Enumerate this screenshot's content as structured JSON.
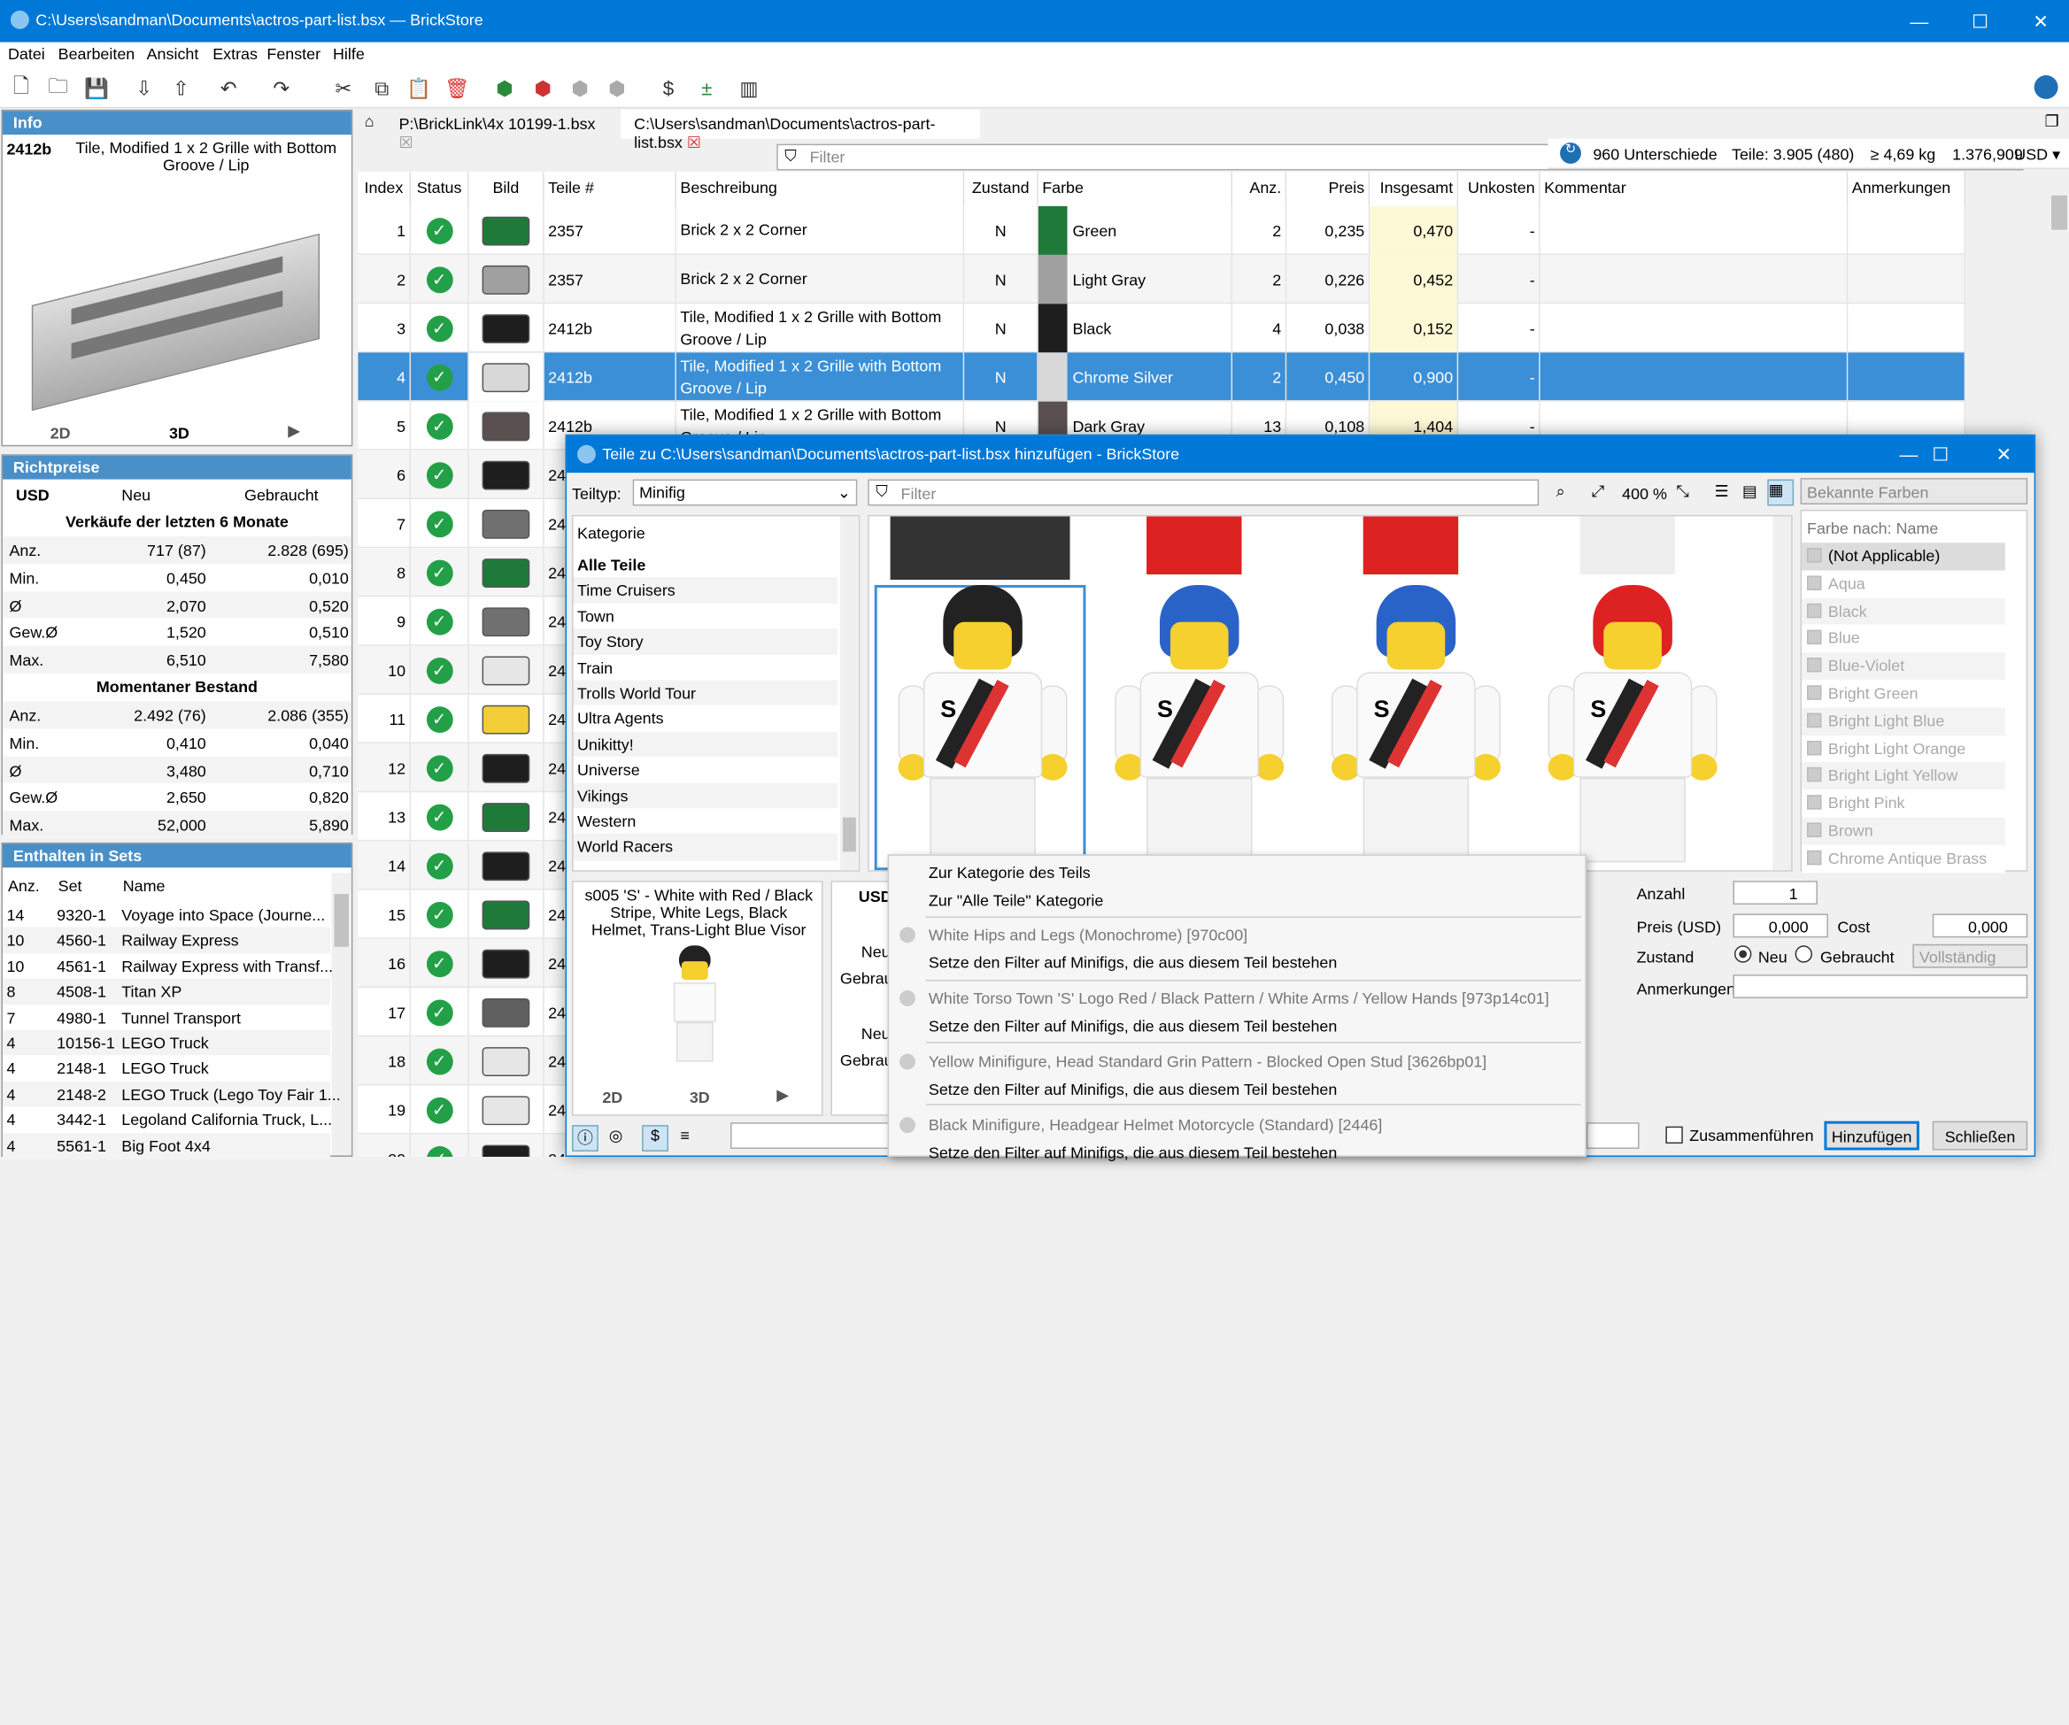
{
  "window": {
    "title": "C:\\Users\\sandman\\Documents\\actros-part-list.bsx — BrickStore"
  },
  "menu": [
    "Datei",
    "Bearbeiten",
    "Ansicht",
    "Extras",
    "Fenster",
    "Hilfe"
  ],
  "toolbar": {
    "filter_placeholder": "Filter"
  },
  "info": {
    "header": "Info",
    "part_id": "2412b",
    "part_name": "Tile, Modified 1 x 2 Grille with Bottom Groove / Lip",
    "tab_2d": "2D",
    "tab_3d": "3D"
  },
  "prices": {
    "header": "Richtpreise",
    "currency": "USD",
    "col_new": "Neu",
    "col_used": "Gebraucht",
    "sales_title": "Verkäufe der letzten 6 Monate",
    "stock_title": "Momentaner Bestand",
    "sales": [
      {
        "label": "Anz.",
        "new": "717 (87)",
        "used": "2.828 (695)"
      },
      {
        "label": "Min.",
        "new": "0,450",
        "used": "0,010"
      },
      {
        "label": "Ø",
        "new": "2,070",
        "used": "0,520"
      },
      {
        "label": "Gew.Ø",
        "new": "1,520",
        "used": "0,510"
      },
      {
        "label": "Max.",
        "new": "6,510",
        "used": "7,580"
      }
    ],
    "stock": [
      {
        "label": "Anz.",
        "new": "2.492 (76)",
        "used": "2.086 (355)"
      },
      {
        "label": "Min.",
        "new": "0,410",
        "used": "0,040"
      },
      {
        "label": "Ø",
        "new": "3,480",
        "used": "0,710"
      },
      {
        "label": "Gew.Ø",
        "new": "2,650",
        "used": "0,820"
      },
      {
        "label": "Max.",
        "new": "52,000",
        "used": "5,890"
      }
    ]
  },
  "sets": {
    "header": "Enthalten in Sets",
    "cols": [
      "Anz.",
      "Set",
      "Name"
    ],
    "rows": [
      [
        "14",
        "9320-1",
        "Voyage into Space (Journe..."
      ],
      [
        "10",
        "4560-1",
        "Railway Express"
      ],
      [
        "10",
        "4561-1",
        "Railway Express with Transf..."
      ],
      [
        "8",
        "4508-1",
        "Titan XP"
      ],
      [
        "7",
        "4980-1",
        "Tunnel Transport"
      ],
      [
        "4",
        "10156-1",
        "LEGO Truck"
      ],
      [
        "4",
        "2148-1",
        "LEGO Truck"
      ],
      [
        "4",
        "2148-2",
        "LEGO Truck (Lego Toy Fair 1..."
      ],
      [
        "4",
        "3442-1",
        "Legoland California Truck, L..."
      ],
      [
        "4",
        "5561-1",
        "Big Foot 4x4"
      ]
    ]
  },
  "tabs": [
    "P:\\BrickLink\\4x 10199-1.bsx",
    "C:\\Users\\sandman\\Documents\\actros-part-list.bsx"
  ],
  "status": {
    "diffs": "960 Unterschiede",
    "parts": "Teile: 3.905 (480)",
    "weight": "≥ 4,69 kg",
    "total": "1.376,909",
    "currency": "USD"
  },
  "grid": {
    "cols": [
      "Index",
      "Status",
      "Bild",
      "Teile #",
      "Beschreibung",
      "Zustand",
      "Farbe",
      "Anz.",
      "Preis",
      "Insgesamt",
      "Unkosten",
      "Kommentar",
      "Anmerkungen"
    ],
    "rows": [
      {
        "i": "1",
        "part": "2357",
        "desc": "Brick 2 x 2 Corner",
        "cond": "N",
        "color": "Green",
        "hex": "#1f7a3a",
        "qty": "2",
        "price": "0,235",
        "total": "0,470",
        "cost": "-"
      },
      {
        "i": "2",
        "part": "2357",
        "desc": "Brick 2 x 2 Corner",
        "cond": "N",
        "color": "Light Gray",
        "hex": "#a0a0a0",
        "qty": "2",
        "price": "0,226",
        "total": "0,452",
        "cost": "-"
      },
      {
        "i": "3",
        "part": "2412b",
        "desc": "Tile, Modified 1 x 2 Grille with Bottom Groove / Lip",
        "cond": "N",
        "color": "Black",
        "hex": "#1e1e1e",
        "qty": "4",
        "price": "0,038",
        "total": "0,152",
        "cost": "-"
      },
      {
        "i": "4",
        "part": "2412b",
        "desc": "Tile, Modified 1 x 2 Grille with Bottom Groove / Lip",
        "cond": "N",
        "color": "Chrome Silver",
        "hex": "#d8d8d8",
        "qty": "2",
        "price": "0,450",
        "total": "0,900",
        "cost": "-"
      },
      {
        "i": "5",
        "part": "2412b",
        "desc": "Tile, Modified 1 x 2 Grille with Bottom Groove / Lip",
        "cond": "N",
        "color": "Dark Gray",
        "hex": "#5a5050",
        "qty": "13",
        "price": "0,108",
        "total": "1,404",
        "cost": "-"
      }
    ],
    "more_indices": [
      "6",
      "7",
      "8",
      "9",
      "10",
      "11",
      "12",
      "13",
      "14",
      "15",
      "16",
      "17",
      "18",
      "19",
      "20"
    ],
    "more_part": "24"
  },
  "dialog": {
    "title": "Teile zu C:\\Users\\sandman\\Documents\\actros-part-list.bsx hinzufügen - BrickStore",
    "type_label": "Teiltyp:",
    "type_value": "Minifig",
    "filter_placeholder": "Filter",
    "zoom": "400 %",
    "known_colors": "Bekannte Farben",
    "color_sort": "Farbe nach: Name",
    "category_header": "Kategorie",
    "categories": [
      "Alle Teile",
      "Time Cruisers",
      "Town",
      "Toy Story",
      "Train",
      "Trolls World Tour",
      "Ultra Agents",
      "Unikitty!",
      "Universe",
      "Vikings",
      "Western",
      "World Racers"
    ],
    "colors": [
      "(Not Applicable)",
      "Aqua",
      "Black",
      "Blue",
      "Blue-Violet",
      "Bright Green",
      "Bright Light Blue",
      "Bright Light Orange",
      "Bright Light Yellow",
      "Bright Pink",
      "Brown",
      "Chrome Antique Brass"
    ],
    "selected_part": "s005 'S' - White with Red / Black Stripe, White Legs, Black Helmet, Trans-Light Blue Visor",
    "selected_id": "s005",
    "sel_2d": "2D",
    "sel_3d": "3D",
    "price_cur": "USD",
    "price_new": "Neu",
    "price_used": "Gebrau",
    "qty_label": "Anzahl",
    "qty_value": "1",
    "price_label": "Preis (USD)",
    "price_value": "0,000",
    "cost_label": "Cost",
    "cost_value": "0,000",
    "cond_label": "Zustand",
    "cond_new": "Neu",
    "cond_used": "Gebraucht",
    "complete": "Vollständig",
    "remarks_label": "Anmerkungen",
    "merge": "Zusammenführen",
    "add": "Hinzufügen",
    "close": "Schließen"
  },
  "context": [
    {
      "text": "Zur Kategorie des Teils",
      "gray": false
    },
    {
      "text": "Zur \"Alle Teile\" Kategorie",
      "gray": false
    },
    {
      "text": "White Hips and Legs (Monochrome) [970c00]",
      "gray": true
    },
    {
      "text": "Setze den Filter auf Minifigs, die aus diesem Teil bestehen",
      "gray": false
    },
    {
      "text": "White Torso Town 'S' Logo Red / Black Pattern / White Arms / Yellow Hands [973p14c01]",
      "gray": true
    },
    {
      "text": "Setze den Filter auf Minifigs, die aus diesem Teil bestehen",
      "gray": false
    },
    {
      "text": "Yellow Minifigure, Head Standard Grin Pattern - Blocked Open Stud [3626bp01]",
      "gray": true
    },
    {
      "text": "Setze den Filter auf Minifigs, die aus diesem Teil bestehen",
      "gray": false
    },
    {
      "text": "Black Minifigure, Headgear Helmet Motorcycle (Standard) [2446]",
      "gray": true
    },
    {
      "text": "Setze den Filter auf Minifigs, die aus diesem Teil bestehen",
      "gray": false
    }
  ]
}
